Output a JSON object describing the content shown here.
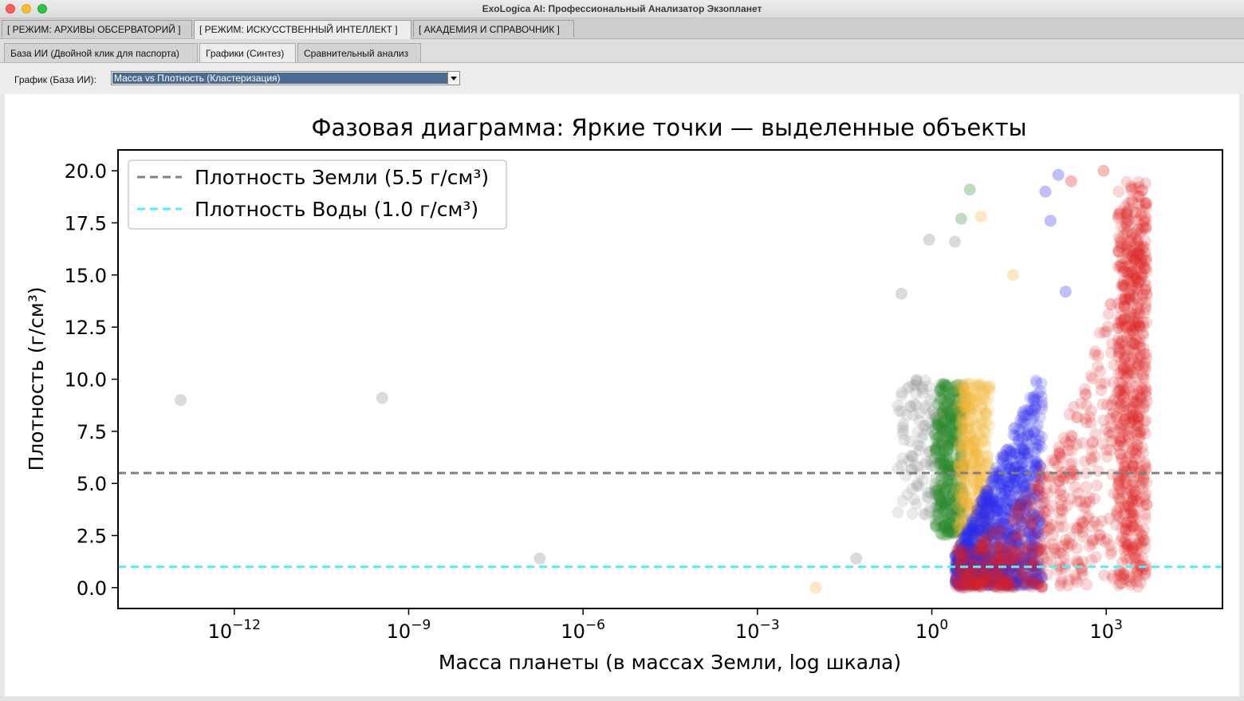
{
  "window": {
    "title": "ExoLogica AI: Профессиональный Анализатор Экзопланет"
  },
  "mode_tabs": [
    {
      "label": "[ РЕЖИМ: АРХИВЫ ОБСЕРВАТОРИЙ ]",
      "active": false
    },
    {
      "label": "[ РЕЖИМ: ИСКУССТВЕННЫЙ ИНТЕЛЛЕКТ ]",
      "active": true
    },
    {
      "label": "[ АКАДЕМИЯ И СПРАВОЧНИК ]",
      "active": false
    }
  ],
  "sub_tabs": [
    {
      "label": "База ИИ (Двойной клик для паспорта)",
      "active": false
    },
    {
      "label": "Графики (Синтез)",
      "active": true
    },
    {
      "label": "Сравнительный анализ",
      "active": false
    }
  ],
  "control": {
    "label": "График (База ИИ):",
    "selected": "Масса vs Плотность (Кластеризация)"
  },
  "icons": {
    "dropdown": "chevron-down-icon"
  },
  "chart_data": {
    "type": "scatter",
    "title": "Фазовая диаграмма: Яркие точки — выделенные объекты",
    "xlabel": "Масса планеты (в массах Земли, log шкала)",
    "ylabel": "Плотность (г/см³)",
    "x_scale": "log",
    "xlim": [
      1e-14,
      100000.0
    ],
    "ylim": [
      -1.0,
      21.0
    ],
    "x_ticks": [
      {
        "value": 1e-12,
        "base": "10",
        "exp": "−12"
      },
      {
        "value": 1e-09,
        "base": "10",
        "exp": "−9"
      },
      {
        "value": 1e-06,
        "base": "10",
        "exp": "−6"
      },
      {
        "value": 0.001,
        "base": "10",
        "exp": "−3"
      },
      {
        "value": 1,
        "base": "10",
        "exp": "0"
      },
      {
        "value": 1000,
        "base": "10",
        "exp": "3"
      }
    ],
    "y_ticks": [
      "0.0",
      "2.5",
      "5.0",
      "7.5",
      "10.0",
      "12.5",
      "15.0",
      "17.5",
      "20.0"
    ],
    "legend_position": "top-left",
    "reference_lines": [
      {
        "label": "Плотность Земли (5.5 г/см³)",
        "y": 5.5,
        "color": "#808080",
        "style": "dashed"
      },
      {
        "label": "Плотность Воды (1.0 г/см³)",
        "y": 1.0,
        "color": "#55eef2",
        "style": "dashed"
      }
    ],
    "clusters": [
      {
        "color": "#888888",
        "log_x_range": [
          -0.6,
          0.25
        ],
        "y_range": [
          3.5,
          10.2
        ],
        "density": "low"
      },
      {
        "color": "#2e8b2e",
        "log_x_range": [
          0.05,
          0.55
        ],
        "y_range": [
          2.5,
          9.8
        ],
        "density": "medium"
      },
      {
        "color": "#f2b53a",
        "log_x_range": [
          0.45,
          1.0
        ],
        "y_range": [
          0.5,
          9.8
        ],
        "density": "medium"
      },
      {
        "color": "#2a2af0",
        "log_x_range": [
          0.4,
          1.9
        ],
        "y_range": [
          0.1,
          10.5
        ],
        "density": "high"
      },
      {
        "color": "#e02020",
        "log_x_range": [
          0.4,
          3.7
        ],
        "y_range": [
          0.0,
          20.0
        ],
        "density": "high"
      }
    ],
    "outliers": [
      {
        "x": 1.2e-13,
        "y": 9.0,
        "color": "#888888"
      },
      {
        "x": 3.5e-10,
        "y": 9.1,
        "color": "#888888"
      },
      {
        "x": 1.8e-07,
        "y": 1.4,
        "color": "#888888"
      },
      {
        "x": 0.05,
        "y": 1.4,
        "color": "#888888"
      },
      {
        "x": 0.01,
        "y": 0.0,
        "color": "#f2b53a"
      },
      {
        "x": 0.3,
        "y": 14.1,
        "color": "#888888"
      },
      {
        "x": 0.9,
        "y": 16.7,
        "color": "#888888"
      },
      {
        "x": 2.5,
        "y": 16.6,
        "color": "#888888"
      },
      {
        "x": 4.5,
        "y": 19.1,
        "color": "#2e8b2e"
      },
      {
        "x": 3.2,
        "y": 17.7,
        "color": "#2e8b2e"
      },
      {
        "x": 7,
        "y": 17.8,
        "color": "#f2b53a"
      },
      {
        "x": 25,
        "y": 15.0,
        "color": "#f2b53a"
      },
      {
        "x": 150,
        "y": 19.8,
        "color": "#2a2af0"
      },
      {
        "x": 90,
        "y": 19.0,
        "color": "#2a2af0"
      },
      {
        "x": 110,
        "y": 17.6,
        "color": "#2a2af0"
      },
      {
        "x": 200,
        "y": 14.2,
        "color": "#2a2af0"
      },
      {
        "x": 250,
        "y": 19.5,
        "color": "#e02020"
      },
      {
        "x": 900,
        "y": 20.0,
        "color": "#e02020"
      },
      {
        "x": 2200,
        "y": 17.5,
        "color": "#e02020"
      },
      {
        "x": 1200,
        "y": 13.6,
        "color": "#e02020"
      },
      {
        "x": 1500,
        "y": 8.2,
        "color": "#e02020"
      }
    ]
  }
}
